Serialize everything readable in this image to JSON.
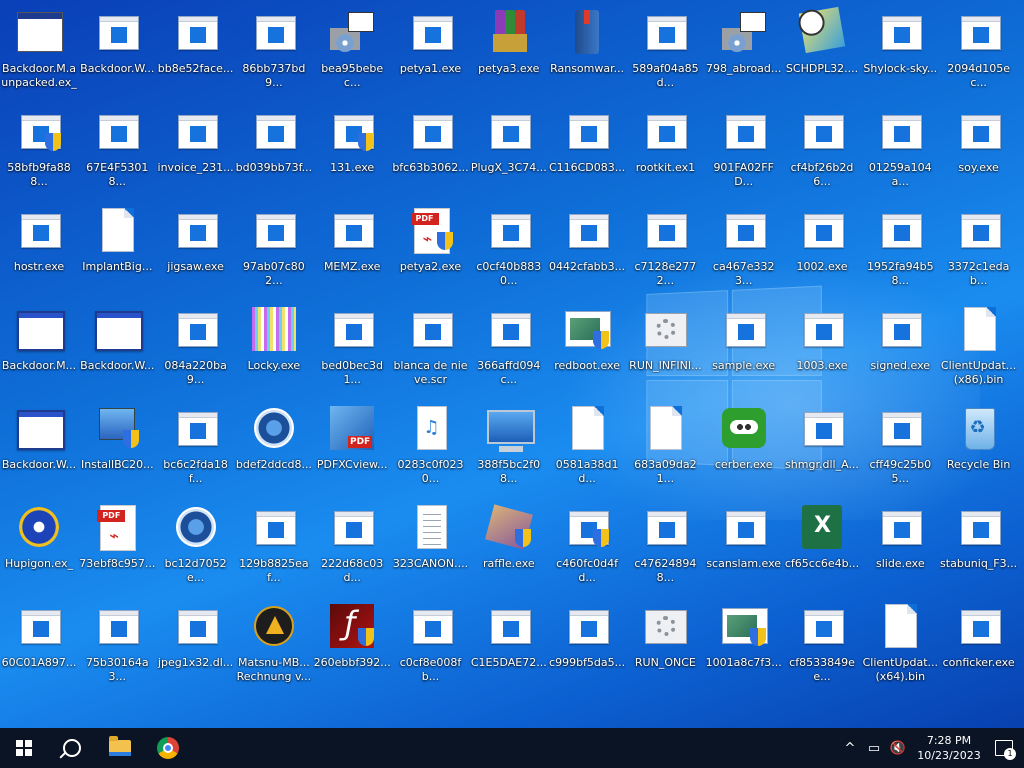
{
  "desktop": {
    "icons": [
      {
        "label": "Backdoor.M.a unpacked.ex_",
        "type": "win-dark"
      },
      {
        "label": "Backdoor.W...",
        "type": "exe"
      },
      {
        "label": "bb8e52face...",
        "type": "exe"
      },
      {
        "label": "86bb737bd9...",
        "type": "exe"
      },
      {
        "label": "bea95bebec...",
        "type": "setup"
      },
      {
        "label": "petya1.exe",
        "type": "exe"
      },
      {
        "label": "petya3.exe",
        "type": "rar"
      },
      {
        "label": "Ransomwar...",
        "type": "book"
      },
      {
        "label": "589af04a85d...",
        "type": "exe"
      },
      {
        "label": "798_abroad...",
        "type": "setup"
      },
      {
        "label": "SCHDPL32....",
        "type": "sched"
      },
      {
        "label": "Shylock-sky...",
        "type": "exe"
      },
      {
        "label": "2094d105ec...",
        "type": "exe"
      },
      {
        "label": "58bfb9fa888...",
        "type": "exe-shield"
      },
      {
        "label": "67E4F53018...",
        "type": "exe"
      },
      {
        "label": "invoice_231...",
        "type": "exe"
      },
      {
        "label": "bd039bb73f...",
        "type": "exe"
      },
      {
        "label": "131.exe",
        "type": "exe-shield"
      },
      {
        "label": "bfc63b3062...",
        "type": "exe"
      },
      {
        "label": "PlugX_3C74...",
        "type": "exe"
      },
      {
        "label": "C116CD083...",
        "type": "exe"
      },
      {
        "label": "rootkit.ex1",
        "type": "exe"
      },
      {
        "label": "901FA02FFD...",
        "type": "exe"
      },
      {
        "label": "cf4bf26b2d6...",
        "type": "exe"
      },
      {
        "label": "01259a104a...",
        "type": "exe"
      },
      {
        "label": "soy.exe",
        "type": "exe"
      },
      {
        "label": "hostr.exe",
        "type": "exe"
      },
      {
        "label": "ImplantBig...",
        "type": "file"
      },
      {
        "label": "jigsaw.exe",
        "type": "exe"
      },
      {
        "label": "97ab07c802...",
        "type": "exe"
      },
      {
        "label": "MEMZ.exe",
        "type": "exe"
      },
      {
        "label": "petya2.exe",
        "type": "pdf-shield"
      },
      {
        "label": "c0cf40b8830...",
        "type": "exe"
      },
      {
        "label": "0442cfabb3...",
        "type": "exe"
      },
      {
        "label": "c7128e2772...",
        "type": "exe"
      },
      {
        "label": "ca467e3323...",
        "type": "exe"
      },
      {
        "label": "1002.exe",
        "type": "exe"
      },
      {
        "label": "1952fa94b58...",
        "type": "exe"
      },
      {
        "label": "3372c1edab...",
        "type": "exe"
      },
      {
        "label": "Backdoor.M...",
        "type": "win"
      },
      {
        "label": "Backdoor.W...",
        "type": "win"
      },
      {
        "label": "084a220ba9...",
        "type": "exe"
      },
      {
        "label": "Locky.exe",
        "type": "locky"
      },
      {
        "label": "bed0bec3d1...",
        "type": "exe"
      },
      {
        "label": "blanca de nieve.scr",
        "type": "exe"
      },
      {
        "label": "366affd094c...",
        "type": "exe"
      },
      {
        "label": "redboot.exe",
        "type": "green-shield"
      },
      {
        "label": "RUN_INFINI...",
        "type": "gear"
      },
      {
        "label": "sample.exe",
        "type": "exe"
      },
      {
        "label": "1003.exe",
        "type": "exe"
      },
      {
        "label": "signed.exe",
        "type": "exe"
      },
      {
        "label": "ClientUpdat... (x86).bin",
        "type": "file"
      },
      {
        "label": "Backdoor.W...",
        "type": "win"
      },
      {
        "label": "InstallBC20...",
        "type": "install"
      },
      {
        "label": "bc6c2fda18f...",
        "type": "exe"
      },
      {
        "label": "bdef2ddcd8...",
        "type": "circle"
      },
      {
        "label": "PDFXCview...",
        "type": "pdfx"
      },
      {
        "label": "0283c0f0230...",
        "type": "music"
      },
      {
        "label": "388f5bc2f08...",
        "type": "pc"
      },
      {
        "label": "0581a38d1d...",
        "type": "file"
      },
      {
        "label": "683a09da21...",
        "type": "file"
      },
      {
        "label": "cerber.exe",
        "type": "cerber"
      },
      {
        "label": "shmgr.dll_A...",
        "type": "exe"
      },
      {
        "label": "cff49c25b05...",
        "type": "exe"
      },
      {
        "label": "Recycle Bin",
        "type": "recycle"
      },
      {
        "label": "Hupigon.ex_",
        "type": "play"
      },
      {
        "label": "73ebf8c957...",
        "type": "pdf"
      },
      {
        "label": "bc12d7052e...",
        "type": "circle"
      },
      {
        "label": "129b8825eaf...",
        "type": "exe"
      },
      {
        "label": "222d68c03d...",
        "type": "exe"
      },
      {
        "label": "323CANON....",
        "type": "doc"
      },
      {
        "label": "raffle.exe",
        "type": "raffle"
      },
      {
        "label": "c460fc0d4fd...",
        "type": "exe-shield"
      },
      {
        "label": "c476248948...",
        "type": "exe"
      },
      {
        "label": "scanslam.exe",
        "type": "exe"
      },
      {
        "label": "cf65cc6e4b...",
        "type": "excel"
      },
      {
        "label": "slide.exe",
        "type": "exe"
      },
      {
        "label": "stabuniq_F3...",
        "type": "exe"
      },
      {
        "label": "60C01A897...",
        "type": "exe"
      },
      {
        "label": "75b30164a3...",
        "type": "exe"
      },
      {
        "label": "jpeg1x32.dl...",
        "type": "exe"
      },
      {
        "label": "Matsnu-MB... Rechnung v...",
        "type": "aimp"
      },
      {
        "label": "260ebbf392...",
        "type": "flash-shield"
      },
      {
        "label": "c0cf8e008fb...",
        "type": "exe"
      },
      {
        "label": "C1E5DAE72...",
        "type": "exe"
      },
      {
        "label": "c999bf5da5...",
        "type": "exe"
      },
      {
        "label": "RUN_ONCE",
        "type": "gear"
      },
      {
        "label": "1001a8c7f3...",
        "type": "green-shield"
      },
      {
        "label": "cf8533849ee...",
        "type": "exe"
      },
      {
        "label": "ClientUpdat... (x64).bin",
        "type": "file"
      },
      {
        "label": "conficker.exe",
        "type": "exe"
      }
    ]
  },
  "taskbar": {
    "start_icon": "windows-start-icon",
    "search_icon": "search-icon",
    "pinned": [
      "file-explorer-icon",
      "chrome-icon"
    ],
    "tray_chevron": "^",
    "clock_time": "7:28 PM",
    "clock_date": "10/23/2023",
    "notification_count": "1"
  }
}
